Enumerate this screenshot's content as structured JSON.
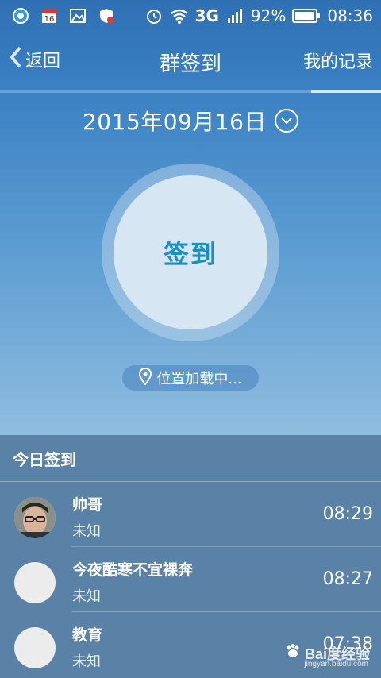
{
  "status_bar": {
    "network": "3G",
    "battery_percent": "92%",
    "time": "08:36",
    "calendar_day": "16",
    "icons": [
      "app-icon",
      "calendar-icon",
      "image-icon",
      "shield-icon",
      "alarm-icon",
      "wifi-icon",
      "signal-icon",
      "battery-icon"
    ]
  },
  "nav": {
    "back_label": "返回",
    "title": "群签到",
    "records_label": "我的记录"
  },
  "date": {
    "text": "2015年09月16日"
  },
  "checkin": {
    "label": "签到"
  },
  "location": {
    "text": "位置加载中..."
  },
  "list": {
    "header": "今日签到",
    "items": [
      {
        "name": "帅哥",
        "status": "未知",
        "time": "08:29"
      },
      {
        "name": "今夜酷寒不宜裸奔",
        "status": "未知",
        "time": "08:27"
      },
      {
        "name": "教育",
        "status": "未知",
        "time": "07:38"
      }
    ]
  },
  "watermark": {
    "text": "Bai度经验",
    "sub": "jingyan.baidu.com"
  },
  "colors": {
    "accent": "#1b8fc5",
    "list_bg": "#5a82a6",
    "header_bg": "#2f70b3"
  }
}
